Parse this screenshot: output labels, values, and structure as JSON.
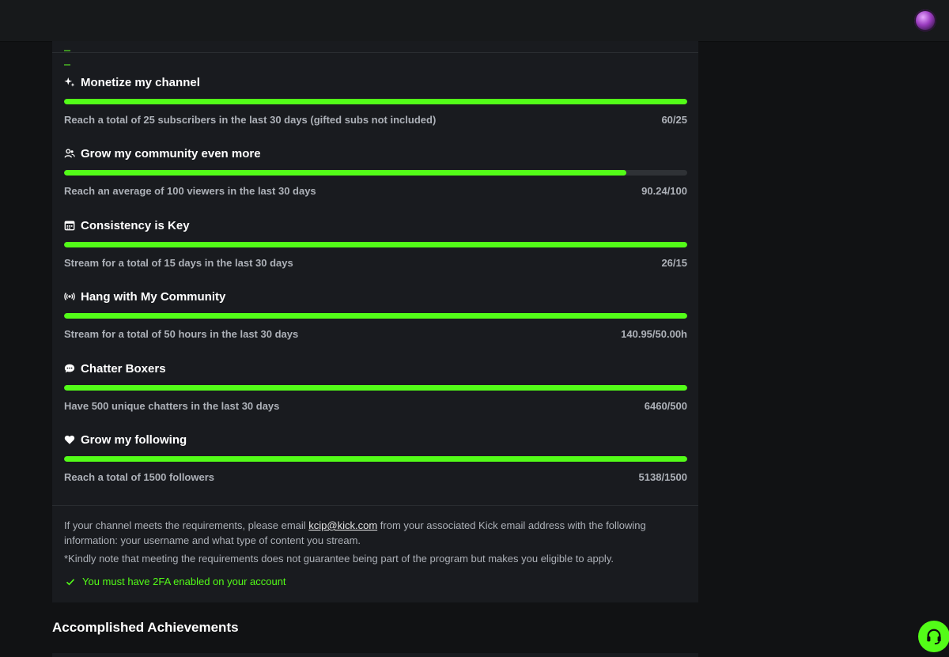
{
  "header": {
    "avatar_icon": "user-avatar"
  },
  "requirements": [
    {
      "icon": "sparkle-icon",
      "title": "Monetize my channel",
      "description": "Reach a total of 25 subscribers in the last 30 days (gifted subs not included)",
      "progress_text": "60/25",
      "progress_fraction": 1.0
    },
    {
      "icon": "users-icon",
      "title": "Grow my community even more",
      "description": "Reach an average of 100 viewers in the last 30 days",
      "progress_text": "90.24/100",
      "progress_fraction": 0.9024
    },
    {
      "icon": "calendar-icon",
      "title": "Consistency is Key",
      "description": "Stream for a total of 15 days in the last 30 days",
      "progress_text": "26/15",
      "progress_fraction": 1.0
    },
    {
      "icon": "broadcast-icon",
      "title": "Hang with My Community",
      "description": "Stream for a total of 50 hours in the last 30 days",
      "progress_text": "140.95/50.00h",
      "progress_fraction": 1.0
    },
    {
      "icon": "chat-bubble-icon",
      "title": "Chatter Boxers",
      "description": "Have 500 unique chatters in the last 30 days",
      "progress_text": "6460/500",
      "progress_fraction": 1.0
    },
    {
      "icon": "heart-icon",
      "title": "Grow my following",
      "description": "Reach a total of 1500 followers",
      "progress_text": "5138/1500",
      "progress_fraction": 1.0
    }
  ],
  "info": {
    "text_before": "If your channel meets the requirements, please email ",
    "email": "kcip@kick.com",
    "text_after": " from your associated Kick email address with the following information: your username and what type of content you stream.",
    "note": "*Kindly note that meeting the requirements does not guarantee being part of the program but makes you eligible to apply.",
    "tfa": "You must have 2FA enabled on your account"
  },
  "section": {
    "title": "Accomplished Achievements"
  },
  "colors": {
    "accent": "#53fc18",
    "card_bg": "#191b1f",
    "page_bg": "#111214",
    "muted_text": "#adb1b8"
  }
}
